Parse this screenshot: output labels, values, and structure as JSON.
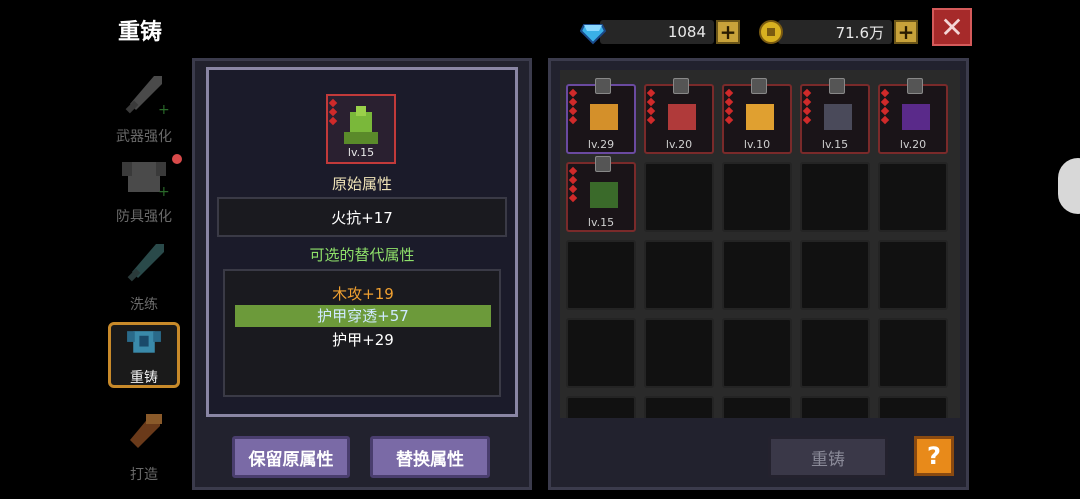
{
  "header": {
    "title": "重铸"
  },
  "currency": {
    "gems": {
      "value": "1084",
      "icon": "diamond-icon"
    },
    "gold": {
      "value": "71.6万",
      "icon": "coin-icon"
    }
  },
  "sidebar": {
    "items": [
      {
        "label": "武器强化"
      },
      {
        "label": "防具强化"
      },
      {
        "label": "洗练"
      },
      {
        "label": "重铸"
      },
      {
        "label": "打造"
      }
    ]
  },
  "left_panel": {
    "item_level": "lv.15",
    "original_title": "原始属性",
    "original_value": "火抗+17",
    "alt_title": "可选的替代属性",
    "alt_options": [
      {
        "text": "木攻+19",
        "color": "#f0a030"
      },
      {
        "text": "护甲穿透+57",
        "color": "#cfe9ff"
      },
      {
        "text": "护甲+29",
        "color": "#ffffff"
      }
    ],
    "keep_button": "保留原属性",
    "replace_button": "替换属性"
  },
  "inventory": {
    "items": [
      {
        "level": "lv.29",
        "color": "#d4902a"
      },
      {
        "level": "lv.20",
        "color": "#b03a3a"
      },
      {
        "level": "lv.10",
        "color": "#e0a030"
      },
      {
        "level": "lv.15",
        "color": "#4a4a5a"
      },
      {
        "level": "lv.20",
        "color": "#5a2a8a"
      },
      {
        "level": "lv.15",
        "color": "#3a6a2a"
      }
    ]
  },
  "footer": {
    "reforge_button": "重铸",
    "help_button": "?"
  },
  "colors": {
    "accent_orange": "#c88a2a",
    "button_purple": "#7a6aa6"
  }
}
